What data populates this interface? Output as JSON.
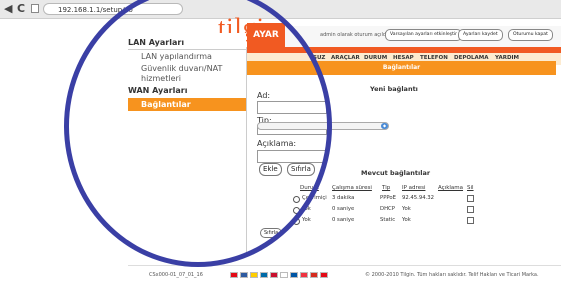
{
  "browser": {
    "url": "192.168.1.1/setup/co",
    "reload_glyph": "C"
  },
  "brand": {
    "logo": "tilgin",
    "accent": "#f15a22",
    "secondary": "#f7931e",
    "circle": "#3a3fa5"
  },
  "header": {
    "active_tab": "AYAR",
    "status_message": "admin olarak oturum açıldı",
    "buttons": [
      "Varsayılan ayarları etkinleştir",
      "Ayarları kaydet",
      "Oturumu kapat"
    ]
  },
  "menu": [
    "SUZ",
    "ARAÇLAR",
    "DURUM",
    "HESAP",
    "TELEFON",
    "DEPOLAMA",
    "YARDIM"
  ],
  "sidebar": {
    "lan_heading": "LAN Ayarları",
    "lan_items": [
      "LAN yapılandırma",
      "Güvenlik duvarı/NAT",
      "hizmetleri"
    ],
    "wan_heading": "WAN Ayarları",
    "wan_active": "Bağlantılar"
  },
  "main": {
    "section_title": "Bağlantılar",
    "new_heading": "Yeni bağlantı",
    "name_label": "Ad:",
    "type_label": "Tip:",
    "desc_label": "Açıklama:",
    "add_button": "Ekle",
    "reset_button": "Sıfırla",
    "existing_heading": "Mevcut bağlantılar",
    "columns": [
      "Durum",
      "Çalışma süresi",
      "Tip",
      "IP adresi",
      "Açıklama",
      "Sil"
    ],
    "rows": [
      {
        "status": "Çevrimiçi",
        "uptime": "3 dakika",
        "type": "PPPoE",
        "ip": "92.45.94.32",
        "desc": ""
      },
      {
        "status": "Yok",
        "uptime": "0 saniye",
        "type": "DHCP",
        "ip": "Yok",
        "desc": ""
      },
      {
        "status": "Yok",
        "uptime": "0 saniye",
        "type": "Static",
        "ip": "Yok",
        "desc": ""
      }
    ],
    "bottom_reset": "Sıfırla"
  },
  "footer": {
    "version": "CSx000-01_07_01_16",
    "copyright": "© 2000-2010 Tilgin. Tüm hakları saklıdır. Telif Hakları ve Ticari Marka."
  }
}
